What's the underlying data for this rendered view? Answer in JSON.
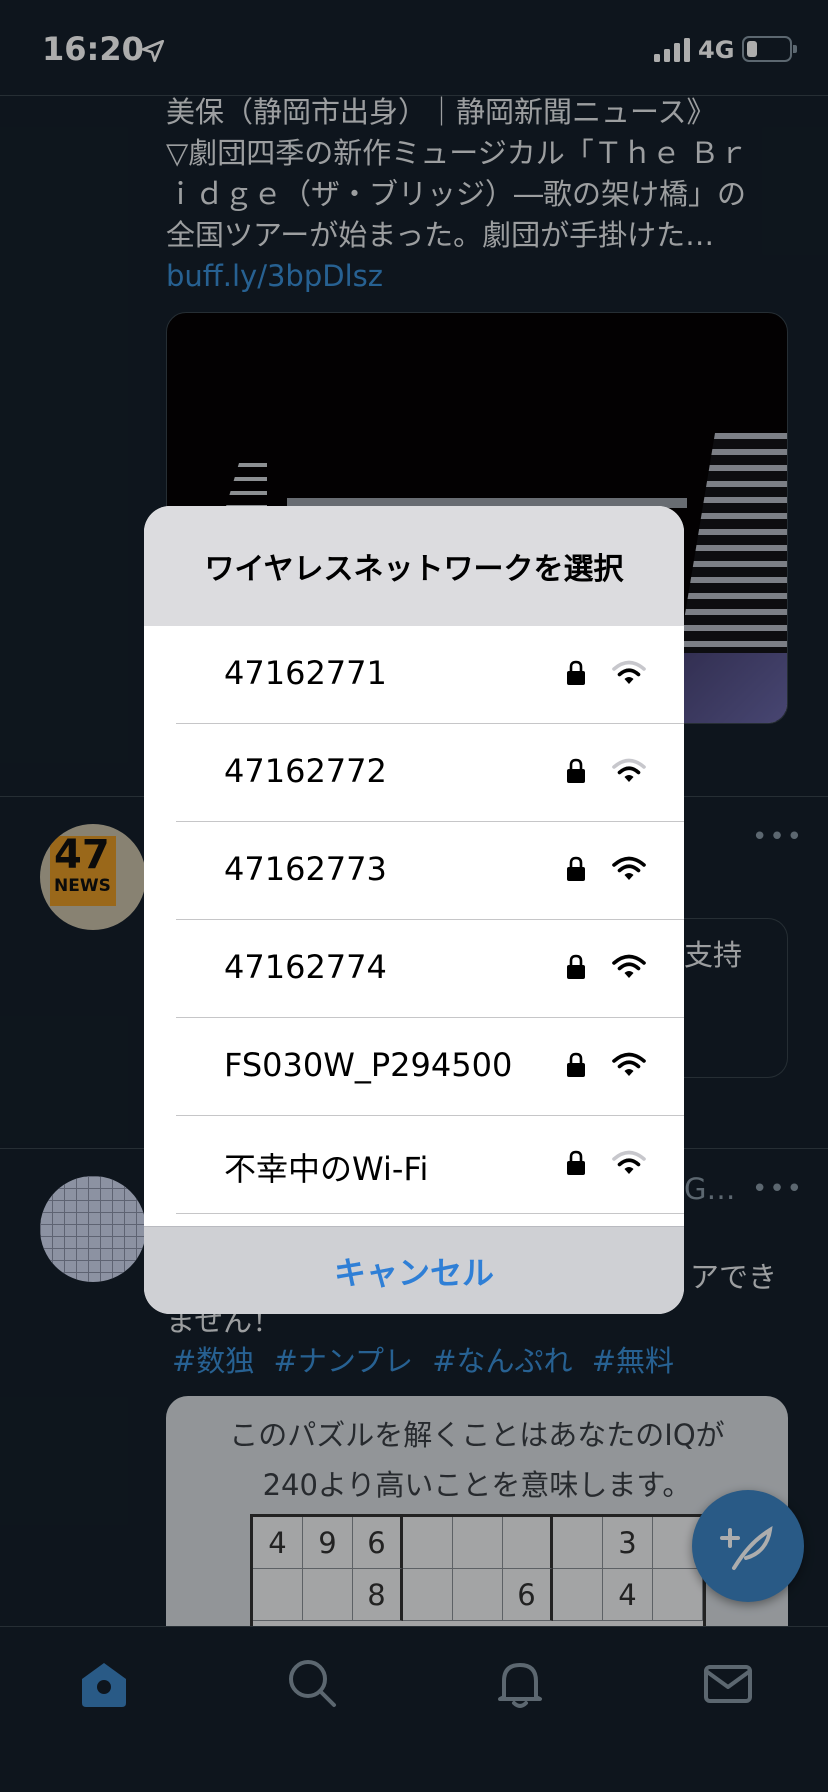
{
  "status_bar": {
    "time": "16:20",
    "network": "4G"
  },
  "feed": {
    "tweet1": {
      "lines": [
        "美保（静岡市出身）｜静岡新聞ニュース》",
        "▽劇団四季の新作ミュージカル「Ｔｈｅ Ｂｒ",
        "ｉｄｇｅ（ザ・ブリッジ）―歌の架け橋」の",
        "全国ツアーが始まった。劇団が手掛けた…"
      ],
      "link": "buff.ly/3bpDlsz"
    },
    "avatar1": {
      "number": "47",
      "label": "NEWS"
    },
    "tweet2_peek": "支持",
    "tweet3_peek_name": "G…",
    "tweet3_peek_line1": "アでき",
    "tweet3_peek_line2": "ません！",
    "hashtags": [
      "#数独",
      "#ナンプレ",
      "#なんぷれ",
      "#無料"
    ],
    "puzzle": {
      "line1": "このパズルを解くことはあなたのIQが",
      "line2": "240より高いことを意味します。",
      "row1": [
        "4",
        "9",
        "6",
        "",
        "",
        "",
        "",
        "3",
        ""
      ],
      "row2": [
        "",
        "",
        "8",
        "",
        "",
        "6",
        "",
        "4",
        ""
      ]
    },
    "more_label": "•••"
  },
  "dialog": {
    "title": "ワイヤレスネットワークを選択",
    "networks": [
      {
        "name": "47162771",
        "strength": 2
      },
      {
        "name": "47162772",
        "strength": 2
      },
      {
        "name": "47162773",
        "strength": 3
      },
      {
        "name": "47162774",
        "strength": 3
      },
      {
        "name": "FS030W_P294500",
        "strength": 3
      },
      {
        "name": "不幸中のWi-Fi",
        "strength": 2
      }
    ],
    "cancel": "キャンセル"
  },
  "colors": {
    "accent": "#3a8fd8",
    "background": "#15202b",
    "fab": "#3d85c6"
  },
  "icons": {
    "tabs": [
      "home-icon",
      "search-icon",
      "bell-icon",
      "mail-icon"
    ],
    "fab": "compose-feather-icon"
  }
}
